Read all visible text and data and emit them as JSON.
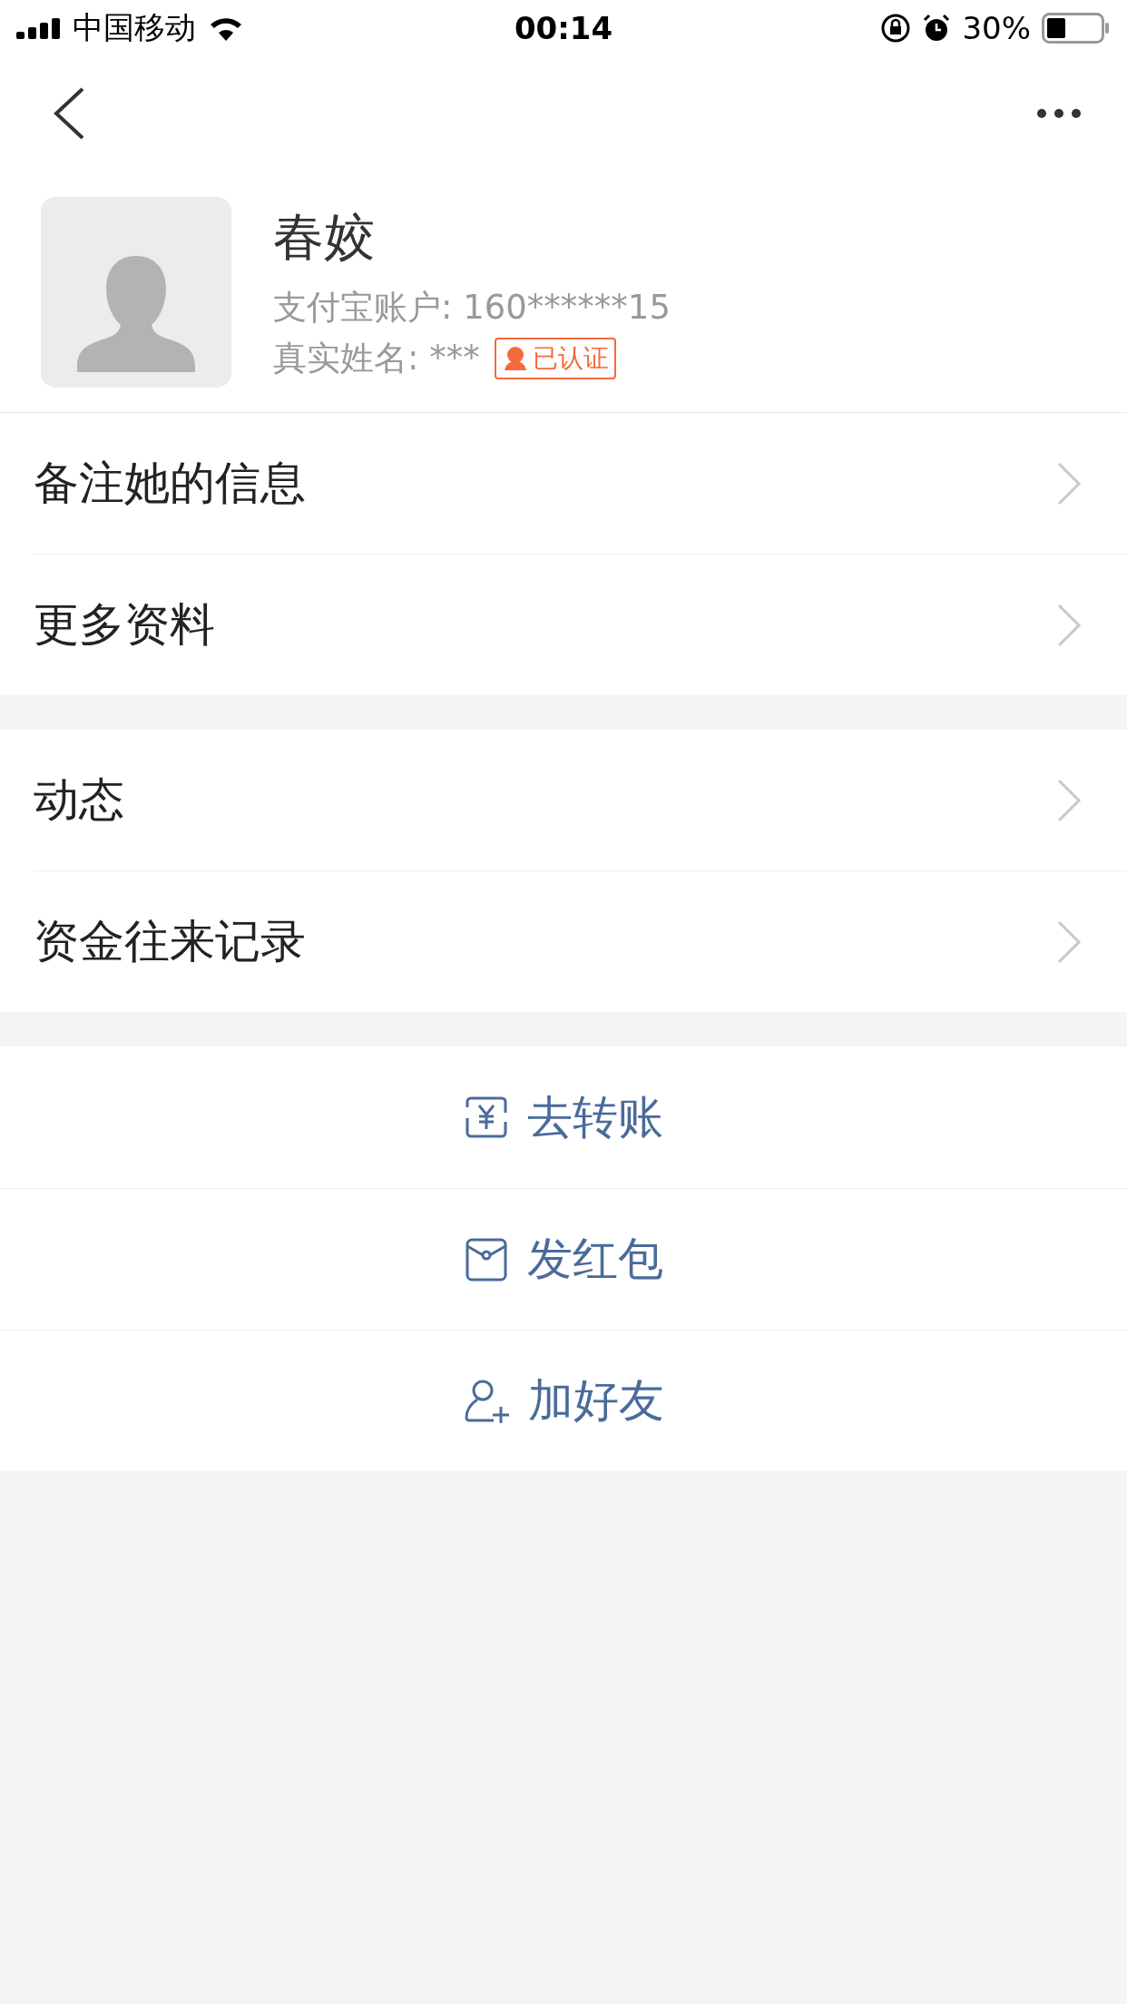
{
  "status_bar": {
    "carrier": "中国移动",
    "time": "00:14",
    "battery": "30%"
  },
  "profile": {
    "name": "春姣",
    "account": "支付宝账户: 160******15",
    "real_name": "真实姓名: ***",
    "verified_badge": "已认证"
  },
  "menu_groups": [
    [
      {
        "label": "备注她的信息"
      },
      {
        "label": "更多资料"
      }
    ],
    [
      {
        "label": "动态"
      },
      {
        "label": "资金往来记录"
      }
    ]
  ],
  "actions": [
    {
      "kind": "transfer",
      "label": "去转账"
    },
    {
      "kind": "red_packet",
      "label": "发红包"
    },
    {
      "kind": "add_friend",
      "label": "加好友"
    }
  ]
}
